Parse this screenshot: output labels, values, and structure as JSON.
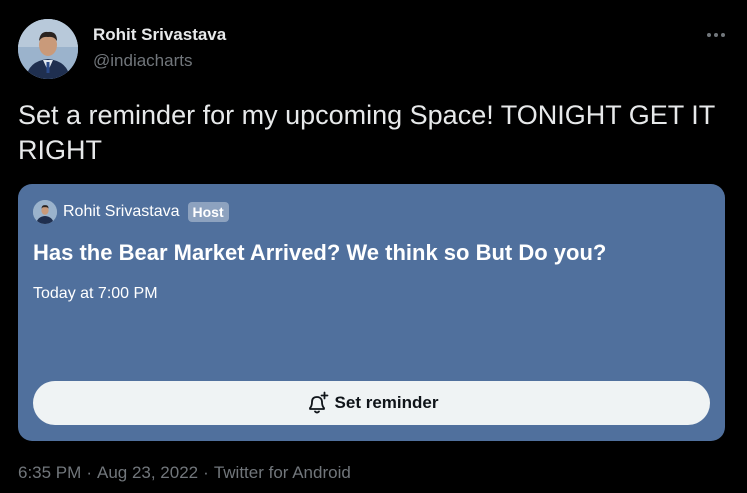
{
  "author": {
    "name": "Rohit Srivastava",
    "handle": "@indiacharts"
  },
  "tweet": {
    "text": "Set a reminder for my upcoming Space! TONIGHT GET IT RIGHT"
  },
  "space": {
    "host_name": "Rohit Srivastava",
    "host_badge": "Host",
    "title": "Has the Bear Market Arrived? We think so But Do you?",
    "time": "Today at 7:00 PM",
    "button_label": "Set reminder",
    "card_color": "#50709d"
  },
  "meta": {
    "time": "6:35 PM",
    "separator": "·",
    "date": "Aug 23, 2022",
    "source": "Twitter for Android"
  },
  "icons": {
    "more": "more-horizontal-icon",
    "reminder": "bell-plus-icon"
  }
}
